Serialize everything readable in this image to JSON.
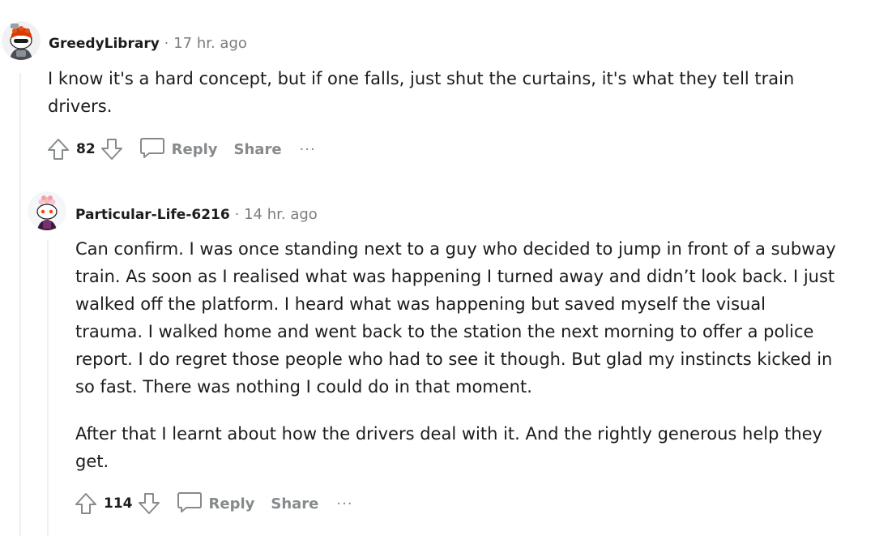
{
  "comments": [
    {
      "username": "GreedyLibrary",
      "separator": "·",
      "time": "17 hr. ago",
      "paragraphs": [
        "I know it's a hard concept, but if one falls, just shut the curtains, it's what they tell train drivers."
      ],
      "score": "82",
      "reply_label": "Reply",
      "share_label": "Share",
      "more_label": "···"
    },
    {
      "username": "Particular-Life-6216",
      "separator": "·",
      "time": "14 hr. ago",
      "paragraphs": [
        "Can confirm. I was once standing next to a guy who decided to jump in front of a subway train. As soon as I realised what was happening I turned away and didn’t look back. I just walked off the platform. I heard what was happening but saved myself the visual trauma. I walked home and went back to the station the next morning to offer a police report. I do regret those people who had to see it though. But glad my instincts kicked in so fast. There was nothing I could do in that moment.",
        "After that I learnt about how the drivers deal with it. And the rightly generous help they get."
      ],
      "score": "114",
      "reply_label": "Reply",
      "share_label": "Share",
      "more_label": "···"
    }
  ],
  "colors": {
    "meta": "#7c7c7c",
    "action": "#878a8c",
    "thread_line": "#edeff1"
  }
}
